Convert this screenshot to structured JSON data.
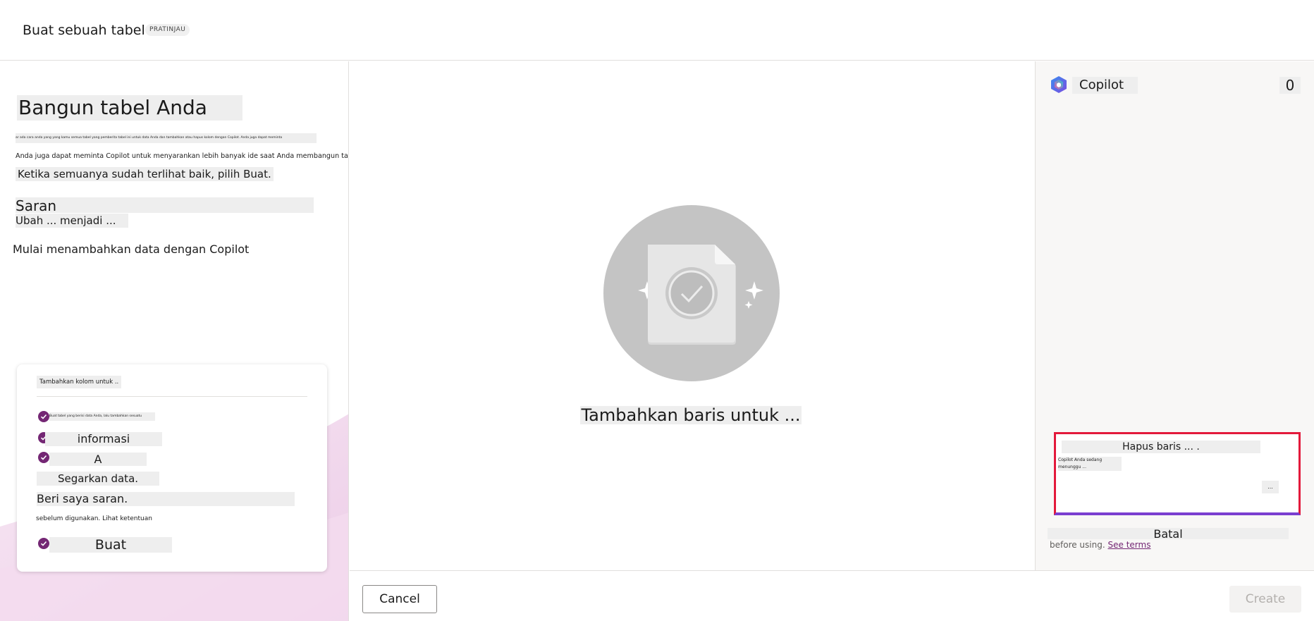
{
  "header": {
    "title": "Buat sebuah tabel",
    "badge": "PRATINJAU"
  },
  "left": {
    "title": "Bangun tabel Anda",
    "desc1": "ar ada cara anda yang yang kamu semua tabel yang pemberita tabel ini untuk data Anda dan tambahkan atau hapus kolom dengan Copilot. Anda juga dapat meminta",
    "desc2": "Anda juga dapat meminta Copilot untuk menyarankan lebih banyak ide saat Anda membangun tabel Anda.",
    "desc3": "Ketika semuanya sudah terlihat baik, pilih Buat.",
    "suggestions_label": "Saran",
    "suggestion_item": "Ubah ... menjadi ...",
    "start_copilot": "Mulai menambahkan data dengan Copilot",
    "card": {
      "heading": "Tambahkan kolom untuk ..",
      "row1": "Buat tabel yang berisi data Anda, lalu tambahkan sesuatu",
      "row2": "informasi",
      "row3": "A",
      "row4": "Segarkan data.",
      "row5": "Beri saya saran.",
      "row6": "sebelum digunakan. Lihat ketentuan",
      "row7": "Buat"
    }
  },
  "center": {
    "label": "Tambahkan baris untuk ..."
  },
  "copilot": {
    "title": "Copilot",
    "count": "0",
    "chat_line1": "Hapus baris ... .",
    "chat_line2": "Copilot Anda sedang menunggu ...",
    "chat_more": "...",
    "batal": "Batal",
    "disclaimer_prefix": "before using.",
    "disclaimer_link": "See terms"
  },
  "footer": {
    "cancel": "Cancel",
    "create": "Create"
  },
  "colors": {
    "accent": "#742774",
    "focus_border": "#e3193b"
  }
}
